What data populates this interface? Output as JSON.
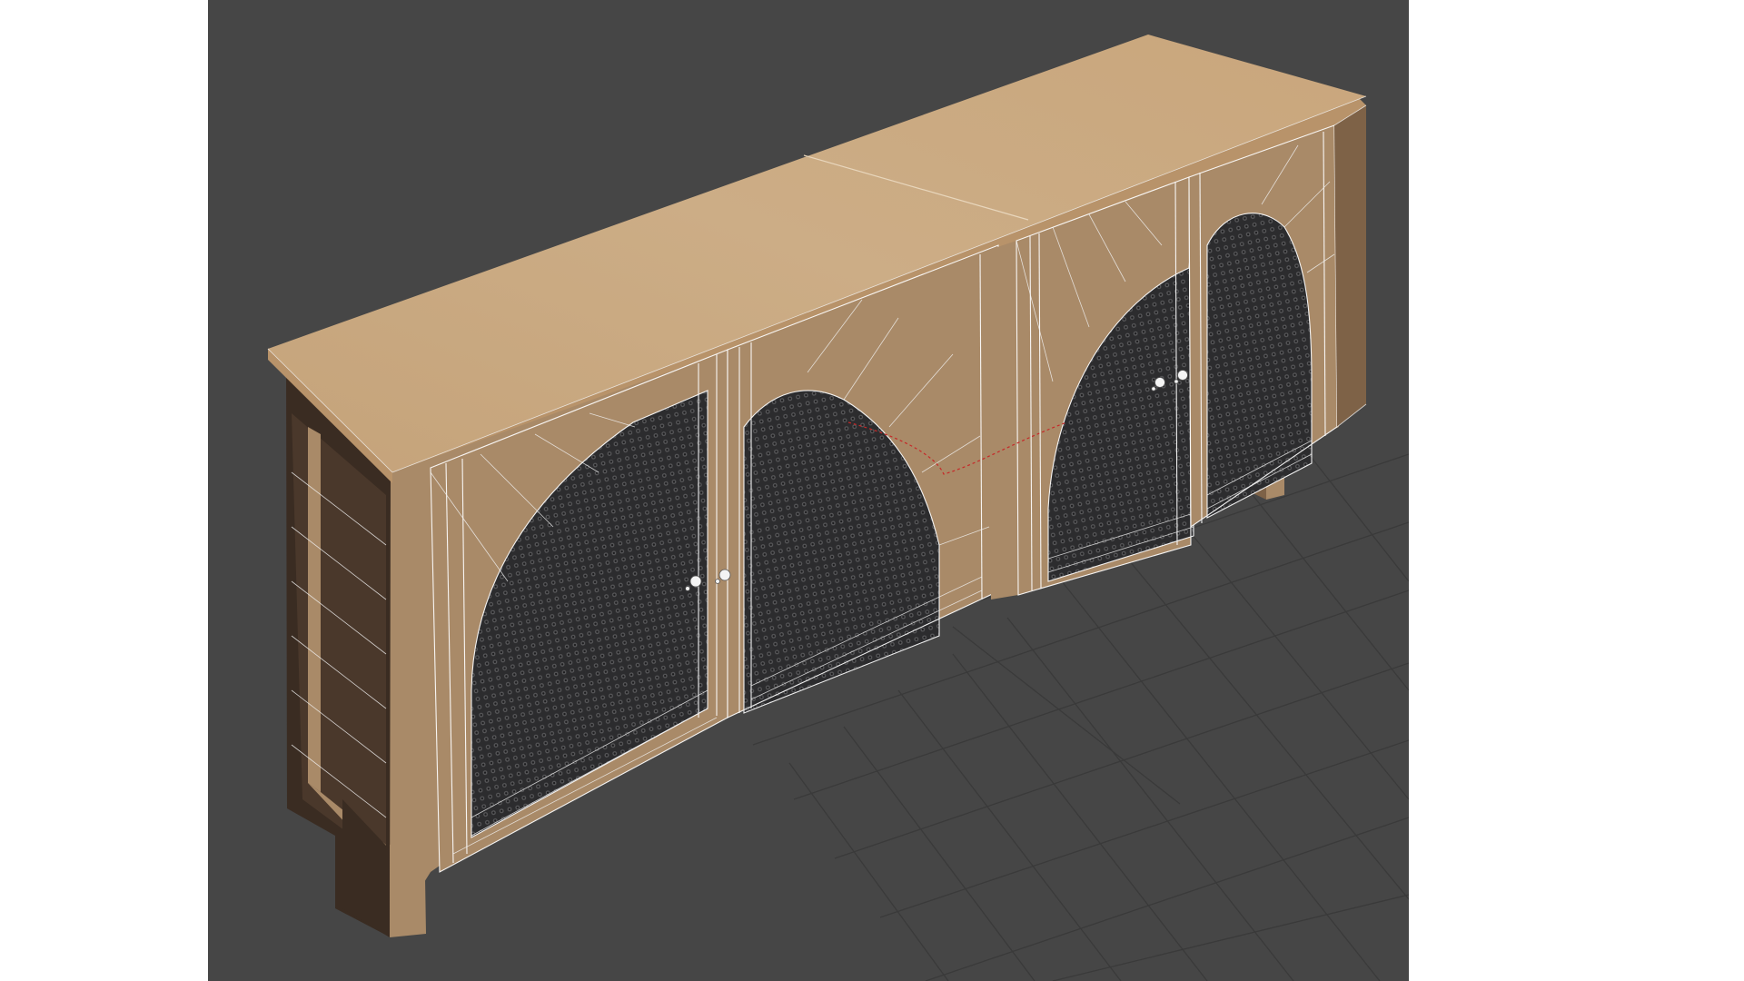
{
  "viewport": {
    "background": "#464646",
    "view_type": "perspective-3d",
    "display_mode": "textured-with-wireframe-overlay",
    "grid": true
  },
  "model": {
    "object": "sideboard-cabinet",
    "door_count": 4,
    "door_style": "arched-mesh-panel",
    "material_top": "#c8a77f",
    "material_body": "#a98a68",
    "material_side": "#3a2c22",
    "wireframe_color": "#ffffff",
    "handle_color": "#f4f4f4"
  }
}
